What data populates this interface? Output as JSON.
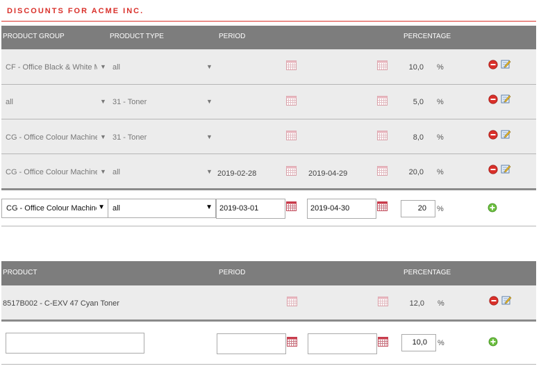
{
  "page": {
    "title": "DISCOUNTS FOR ACME INC."
  },
  "group_table": {
    "headers": {
      "group": "PRODUCT GROUP",
      "type": "PRODUCT TYPE",
      "period": "PERIOD",
      "percentage": "PERCENTAGE"
    },
    "rows": [
      {
        "group": "CF - Office Black & White M",
        "type": "all",
        "from": "",
        "to": "",
        "percentage": "10,0",
        "unit": "%"
      },
      {
        "group": "all",
        "type": "31 - Toner",
        "from": "",
        "to": "",
        "percentage": "5,0",
        "unit": "%"
      },
      {
        "group": "CG - Office Colour Machines",
        "type": "31 - Toner",
        "from": "",
        "to": "",
        "percentage": "8,0",
        "unit": "%"
      },
      {
        "group": "CG - Office Colour Machines",
        "type": "all",
        "from": "2019-02-28",
        "to": "2019-04-29",
        "percentage": "20,0",
        "unit": "%"
      }
    ],
    "new_row": {
      "group": "CG - Office Colour Machines",
      "type": "all",
      "from": "2019-03-01",
      "to": "2019-04-30",
      "percentage": "20",
      "unit": "%"
    }
  },
  "product_table": {
    "headers": {
      "product": "PRODUCT",
      "period": "PERIOD",
      "percentage": "PERCENTAGE"
    },
    "rows": [
      {
        "product": "8517B002 - C-EXV 47 Cyan Toner",
        "from": "",
        "to": "",
        "percentage": "12,0",
        "unit": "%"
      }
    ],
    "new_row": {
      "product": "",
      "from": "",
      "to": "",
      "percentage": "10,0",
      "unit": "%"
    }
  },
  "icons": {
    "calendar": "calendar-icon",
    "delete": "delete-icon",
    "edit": "edit-icon",
    "add": "add-icon"
  },
  "colors": {
    "title": "#d9302a",
    "header_bg": "#7d7d7d",
    "row_bg": "#ececec",
    "delete": "#d9302a",
    "add": "#5aa832"
  }
}
